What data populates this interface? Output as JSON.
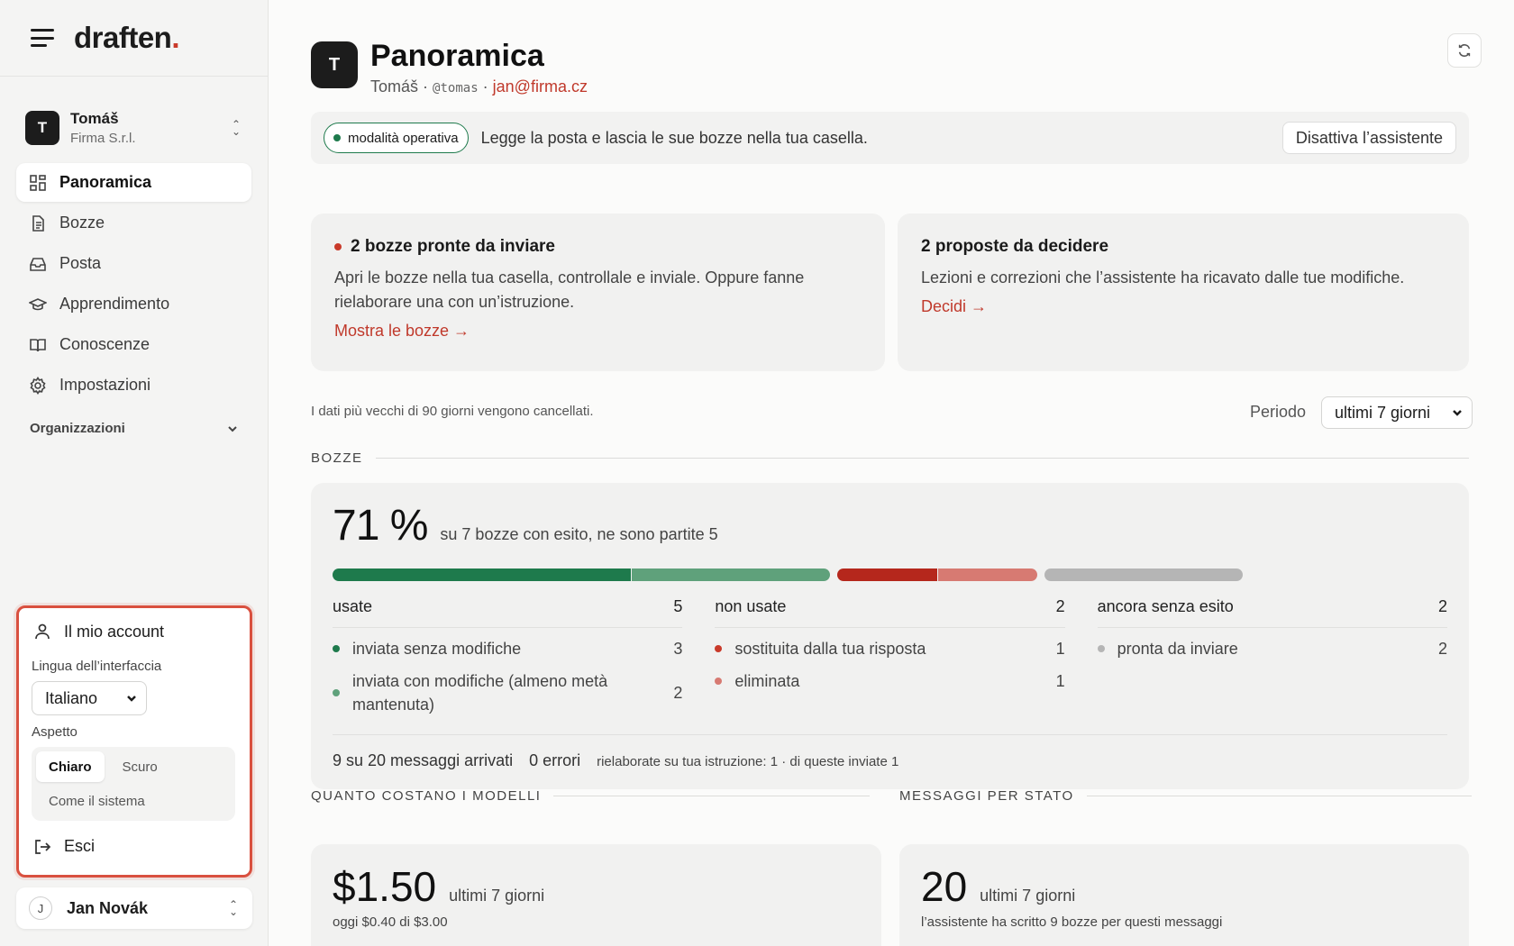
{
  "brand": {
    "name": "draften",
    "dot": "."
  },
  "org": {
    "initial": "T",
    "name": "Tomáš",
    "company": "Firma S.r.l."
  },
  "nav": [
    {
      "label": "Panoramica",
      "icon": "grid-icon",
      "active": true
    },
    {
      "label": "Bozze",
      "icon": "document-icon"
    },
    {
      "label": "Posta",
      "icon": "inbox-icon"
    },
    {
      "label": "Apprendimento",
      "icon": "graduation-cap-icon"
    },
    {
      "label": "Conoscenze",
      "icon": "book-icon"
    },
    {
      "label": "Impostazioni",
      "icon": "gear-icon"
    }
  ],
  "nav_section": "Organizzazioni",
  "account_panel": {
    "title": "Il mio account",
    "language_label": "Lingua dell’interfaccia",
    "language_value": "Italiano",
    "appearance_label": "Aspetto",
    "themes": [
      "Chiaro",
      "Scuro",
      "Come il sistema"
    ],
    "theme_selected": "Chiaro",
    "logout": "Esci"
  },
  "user": {
    "initial": "J",
    "name": "Jan Novák"
  },
  "header": {
    "initial": "T",
    "title": "Panoramica",
    "name": "Tomáš",
    "sep1": "·",
    "handle": "@tomas",
    "sep2": "·",
    "email": "jan@firma.cz"
  },
  "mode": {
    "pill": "modalità operativa",
    "text": "Legge la posta e lascia le sue bozze nella tua casella.",
    "button": "Disattiva l’assistente"
  },
  "cards": {
    "drafts": {
      "title": "2 bozze pronte da inviare",
      "body": "Apri le bozze nella tua casella, controllale e inviale. Oppure fanne rielaborare una con un’istruzione.",
      "link": "Mostra le bozze →"
    },
    "proposals": {
      "title": "2 proposte da decidere",
      "body": "Lezioni e correzioni che l’assistente ha ricavato dalle tue modifiche.",
      "link": "Decidi →"
    }
  },
  "retention": "I dati più vecchi di 90 giorni vengono cancellati.",
  "period": {
    "label": "Periodo",
    "value": "ultimi 7 giorni"
  },
  "section_bozze": "BOZZE",
  "bozze": {
    "kpi": "71 %",
    "kpi_sub": "su 7 bozze con esito, ne sono partite 5",
    "bar": [
      {
        "fraction": 0.2857,
        "color": "#1e7a4c"
      },
      {
        "fraction": 0.1905,
        "color": "#5fa17b"
      },
      {
        "fraction": 0.0952,
        "color": "#b5271c"
      },
      {
        "fraction": 0.0952,
        "color": "#d77a72"
      },
      {
        "fraction": 0.1905,
        "color": "#b5b5b5"
      }
    ],
    "columns": [
      {
        "label": "usate",
        "total": "5",
        "rows": [
          {
            "label": "inviata senza modifiche",
            "value": "3",
            "dot": "g"
          },
          {
            "label": "inviata con modifiche (almeno metà mantenuta)",
            "value": "2",
            "dot": "gl"
          }
        ]
      },
      {
        "label": "non usate",
        "total": "2",
        "rows": [
          {
            "label": "sostituita dalla tua risposta",
            "value": "1",
            "dot": "r"
          },
          {
            "label": "eliminata",
            "value": "1",
            "dot": "rl"
          }
        ]
      },
      {
        "label": "ancora senza esito",
        "total": "2",
        "rows": [
          {
            "label": "pronta da inviare",
            "value": "2",
            "dot": "gr"
          }
        ]
      }
    ],
    "footer": {
      "arrived": "9 su 20 messaggi arrivati",
      "errors": "0 errori",
      "reworked": "rielaborate su tua istruzione: 1 · di queste inviate 1"
    }
  },
  "section_cost": "QUANTO COSTANO I MODELLI",
  "section_status": "MESSAGGI PER STATO",
  "cost": {
    "amount": "$1.50",
    "period": "ultimi 7 giorni",
    "today": "oggi $0.40 di $3.00"
  },
  "messages": {
    "count": "20",
    "period": "ultimi 7 giorni",
    "note": "l’assistente ha scritto 9 bozze per questi messaggi"
  }
}
